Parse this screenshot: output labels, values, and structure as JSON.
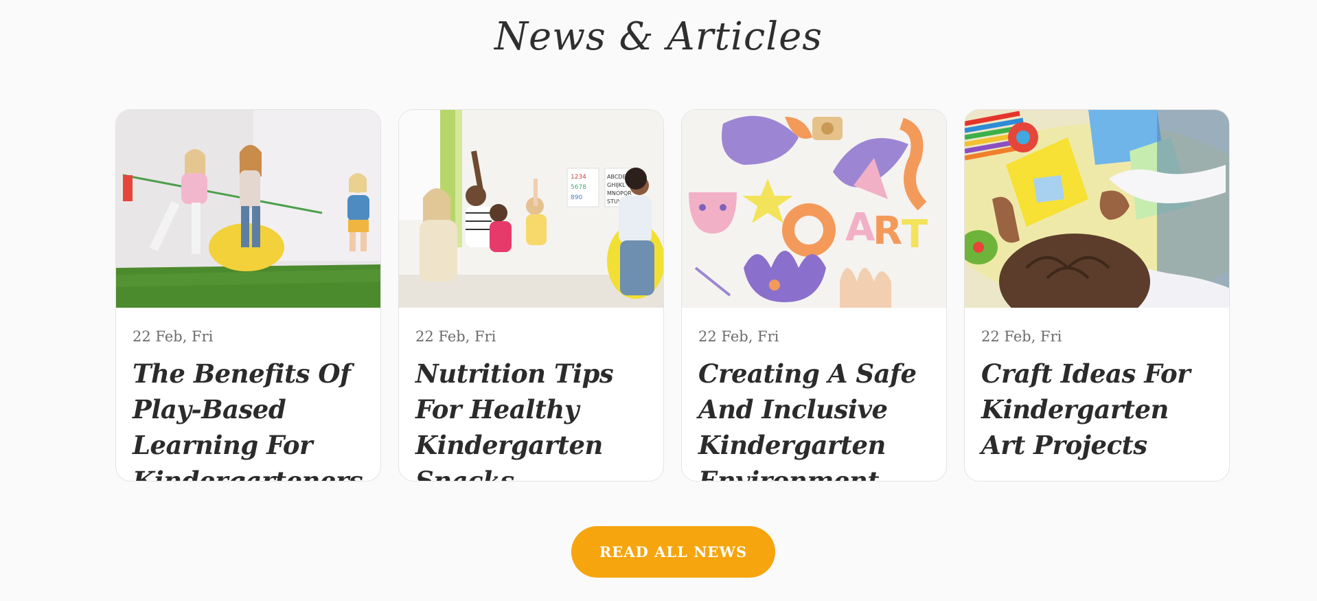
{
  "section": {
    "title": "News & Articles"
  },
  "articles": [
    {
      "date": "22 Feb, Fri",
      "title": "The Benefits Of Play-Based Learning For Kindergarteners",
      "image": "children-tug-of-war-photo"
    },
    {
      "date": "22 Feb, Fri",
      "title": "Nutrition Tips For Healthy Kindergarten Snacks",
      "image": "classroom-raising-hands-photo"
    },
    {
      "date": "22 Feb, Fri",
      "title": "Creating A Safe And Inclusive Kindergarten Environment",
      "image": "paper-art-crafts-photo"
    },
    {
      "date": "22 Feb, Fri",
      "title": "Craft Ideas For Kindergarten Art Projects",
      "image": "colored-paper-crafting-photo"
    }
  ],
  "cta": {
    "label": "READ ALL NEWS"
  },
  "colors": {
    "background": "#fafafa",
    "accent": "#f6a50e",
    "heading": "#2f2f2f"
  }
}
